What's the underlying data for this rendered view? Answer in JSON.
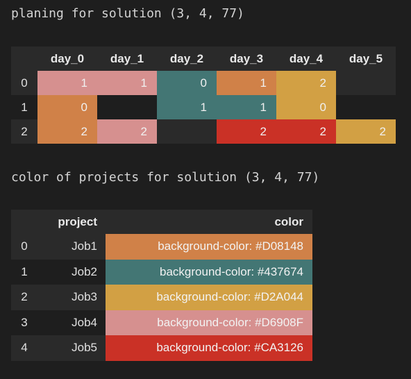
{
  "plan": {
    "title": "planing for solution (3, 4, 77)",
    "columns": [
      "day_0",
      "day_1",
      "day_2",
      "day_3",
      "day_4",
      "day_5"
    ],
    "rows": [
      {
        "index": "0",
        "cells": [
          {
            "value": "1",
            "color": "#D6908F"
          },
          {
            "value": "1",
            "color": "#D6908F"
          },
          {
            "value": "0",
            "color": "#437674"
          },
          {
            "value": "1",
            "color": "#D08148"
          },
          {
            "value": "2",
            "color": "#D2A044"
          },
          {
            "value": "",
            "color": ""
          }
        ]
      },
      {
        "index": "1",
        "cells": [
          {
            "value": "0",
            "color": "#D08148"
          },
          {
            "value": "",
            "color": ""
          },
          {
            "value": "1",
            "color": "#437674"
          },
          {
            "value": "1",
            "color": "#437674"
          },
          {
            "value": "0",
            "color": "#D2A044"
          },
          {
            "value": "",
            "color": ""
          }
        ]
      },
      {
        "index": "2",
        "cells": [
          {
            "value": "2",
            "color": "#D08148"
          },
          {
            "value": "2",
            "color": "#D6908F"
          },
          {
            "value": "",
            "color": ""
          },
          {
            "value": "2",
            "color": "#CA3126"
          },
          {
            "value": "2",
            "color": "#CA3126"
          },
          {
            "value": "2",
            "color": "#D2A044"
          }
        ]
      }
    ]
  },
  "projects": {
    "title": "color of projects for solution (3, 4, 77)",
    "columns": [
      "project",
      "color"
    ],
    "rows": [
      {
        "index": "0",
        "project": "Job1",
        "color_text": "background-color: #D08148",
        "color": "#D08148"
      },
      {
        "index": "1",
        "project": "Job2",
        "color_text": "background-color: #437674",
        "color": "#437674"
      },
      {
        "index": "2",
        "project": "Job3",
        "color_text": "background-color: #D2A044",
        "color": "#D2A044"
      },
      {
        "index": "3",
        "project": "Job4",
        "color_text": "background-color: #D6908F",
        "color": "#D6908F"
      },
      {
        "index": "4",
        "project": "Job5",
        "color_text": "background-color: #CA3126",
        "color": "#CA3126"
      }
    ]
  }
}
